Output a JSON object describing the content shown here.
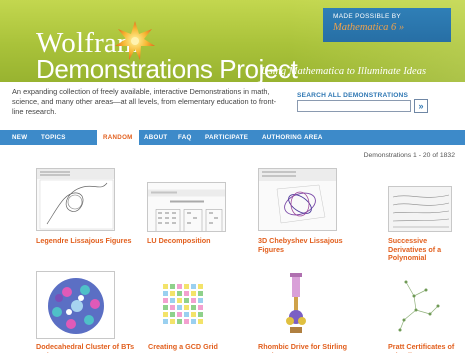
{
  "header": {
    "brand": "Wolfram",
    "project": "Demonstrations Project",
    "tagline": "Using Mathematica to Illuminate Ideas",
    "made_possible_label": "MADE POSSIBLE BY",
    "made_possible_product": "Mathematica 6 »",
    "accent_color": "#e2601f",
    "banner_color": "#a9c23a"
  },
  "intro": {
    "text": "An expanding collection of freely available, interactive Demonstrations in math, science, and many other areas—at all levels, from elementary education to front-line research.",
    "search_label": "SEARCH ALL DEMONSTRATIONS",
    "search_value": "",
    "search_button": "»"
  },
  "nav": {
    "items": [
      {
        "label": "NEW"
      },
      {
        "label": "TOPICS"
      },
      {
        "label": "RANDOM",
        "active": true
      },
      {
        "label": "ABOUT"
      },
      {
        "label": "FAQ"
      },
      {
        "label": "PARTICIPATE"
      },
      {
        "label": "AUTHORING AREA"
      }
    ]
  },
  "results": {
    "count_text": "Demonstrations 1 - 20 of 1832",
    "items": [
      {
        "title": "Legendre Lissajous Figures"
      },
      {
        "title": "LU Decomposition"
      },
      {
        "title": "3D Chebyshev Lissajous Figures"
      },
      {
        "title": "Successive Derivatives of a Polynomial"
      },
      {
        "title": "Dodecahedral Cluster of BTs and BHs"
      },
      {
        "title": "Creating a GCD Grid"
      },
      {
        "title": "Rhombic Drive for Stirling Engine"
      },
      {
        "title": "Pratt Certificates of Primality"
      }
    ]
  }
}
